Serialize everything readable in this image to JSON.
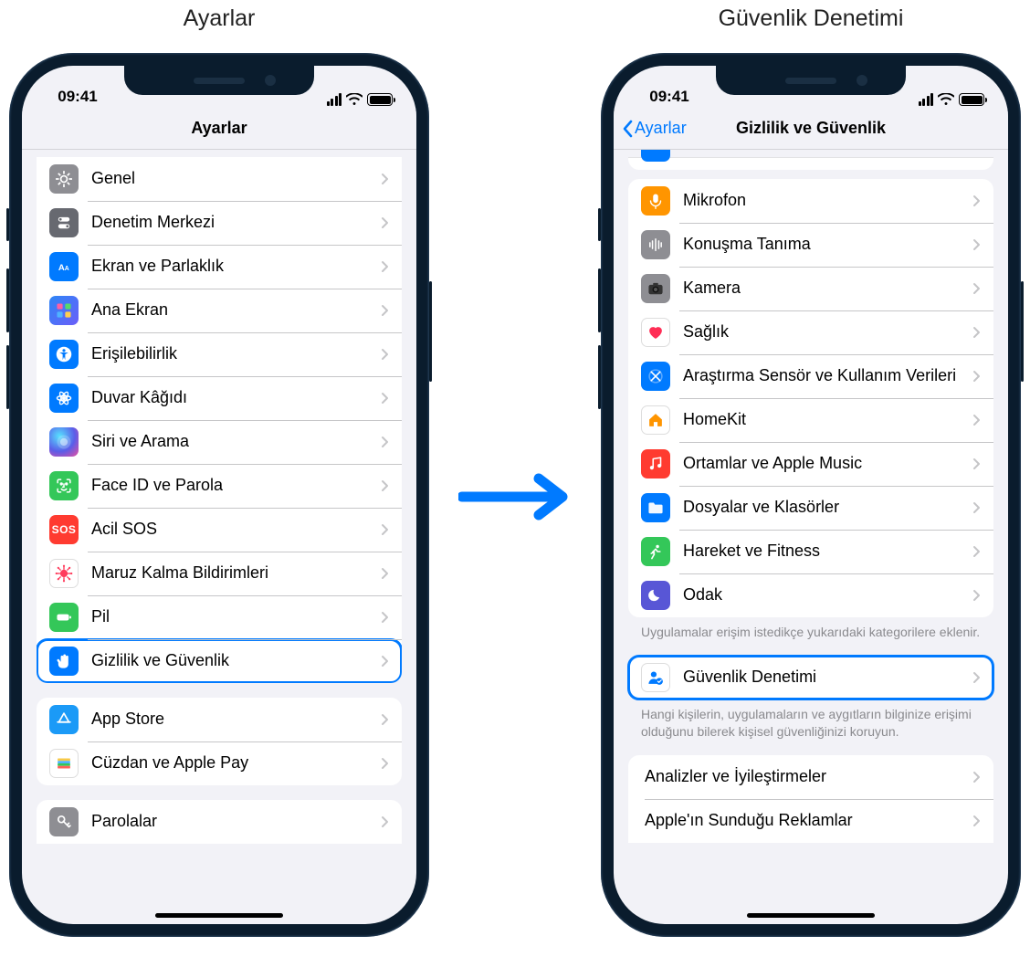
{
  "headings": {
    "left": "Ayarlar",
    "right": "Güvenlik Denetimi"
  },
  "status": {
    "time": "09:41"
  },
  "left_phone": {
    "nav_title": "Ayarlar",
    "groups": [
      {
        "rows": [
          {
            "id": "general",
            "label": "Genel",
            "icon": "gear-icon",
            "bg": "bg-gray"
          },
          {
            "id": "control-center",
            "label": "Denetim Merkezi",
            "icon": "switches-icon",
            "bg": "bg-darkgray"
          },
          {
            "id": "display",
            "label": "Ekran ve Parlaklık",
            "icon": "text-size-icon",
            "bg": "bg-blue"
          },
          {
            "id": "home-screen",
            "label": "Ana Ekran",
            "icon": "apps-grid-icon",
            "bg": "bg-home"
          },
          {
            "id": "accessibility",
            "label": "Erişilebilirlik",
            "icon": "accessibility-icon",
            "bg": "bg-blue"
          },
          {
            "id": "wallpaper",
            "label": "Duvar Kâğıdı",
            "icon": "flower-icon",
            "bg": "bg-blue"
          },
          {
            "id": "siri",
            "label": "Siri ve Arama",
            "icon": "siri-icon",
            "bg": "bg-siri"
          },
          {
            "id": "faceid",
            "label": "Face ID ve Parola",
            "icon": "faceid-icon",
            "bg": "bg-green"
          },
          {
            "id": "sos",
            "label": "Acil SOS",
            "icon": "sos-icon",
            "bg": "bg-red"
          },
          {
            "id": "exposure",
            "label": "Maruz Kalma Bildirimleri",
            "icon": "virus-icon",
            "bg": "bg-white"
          },
          {
            "id": "battery",
            "label": "Pil",
            "icon": "battery-icon",
            "bg": "bg-green"
          },
          {
            "id": "privacy",
            "label": "Gizlilik ve Güvenlik",
            "icon": "hand-icon",
            "bg": "bg-blue",
            "highlight": true
          }
        ]
      },
      {
        "rows": [
          {
            "id": "appstore",
            "label": "App Store",
            "icon": "appstore-icon",
            "bg": "bg-appstore"
          },
          {
            "id": "wallet",
            "label": "Cüzdan ve Apple Pay",
            "icon": "wallet-icon",
            "bg": "bg-white"
          }
        ]
      },
      {
        "partial": true,
        "rows": [
          {
            "id": "passwords",
            "label": "Parolalar",
            "icon": "key-icon",
            "bg": "bg-key"
          }
        ]
      }
    ]
  },
  "right_phone": {
    "nav_title": "Gizlilik ve Güvenlik",
    "back_label": "Ayarlar",
    "sections": [
      {
        "type": "partial_top"
      },
      {
        "type": "group",
        "rows": [
          {
            "id": "microphone",
            "label": "Mikrofon",
            "icon": "mic-icon",
            "bg": "bg-orange"
          },
          {
            "id": "speech",
            "label": "Konuşma Tanıma",
            "icon": "waveform-icon",
            "bg": "bg-mid"
          },
          {
            "id": "camera",
            "label": "Kamera",
            "icon": "camera-icon",
            "bg": "bg-mid"
          },
          {
            "id": "health",
            "label": "Sağlık",
            "icon": "heart-icon",
            "bg": "bg-white"
          },
          {
            "id": "research",
            "label": "Araştırma Sensör ve Kullanım Verileri",
            "icon": "research-icon",
            "bg": "bg-blue"
          },
          {
            "id": "homekit",
            "label": "HomeKit",
            "icon": "home-icon",
            "bg": "bg-white"
          },
          {
            "id": "media",
            "label": "Ortamlar ve Apple Music",
            "icon": "music-icon",
            "bg": "bg-red"
          },
          {
            "id": "files",
            "label": "Dosyalar ve Klasörler",
            "icon": "folder-icon",
            "bg": "bg-blue"
          },
          {
            "id": "motion",
            "label": "Hareket ve Fitness",
            "icon": "running-icon",
            "bg": "bg-green"
          },
          {
            "id": "focus",
            "label": "Odak",
            "icon": "moon-icon",
            "bg": "bg-purple"
          }
        ],
        "footer": "Uygulamalar erişim istedikçe yukarıdaki kategorilere eklenir."
      },
      {
        "type": "group",
        "highlight": true,
        "rows": [
          {
            "id": "safety-check",
            "label": "Güvenlik Denetimi",
            "icon": "person-check-icon",
            "bg": "bg-white"
          }
        ],
        "footer": "Hangi kişilerin, uygulamaların ve aygıtların bilginize erişimi olduğunu bilerek kişisel güvenliğinizi koruyun."
      },
      {
        "type": "group",
        "partial_bottom": true,
        "rows": [
          {
            "id": "analytics",
            "label": "Analizler ve İyileştirmeler",
            "icon": "",
            "bg": "",
            "no_icon": true
          },
          {
            "id": "apple-ads",
            "label": "Apple'ın Sunduğu Reklamlar",
            "icon": "",
            "bg": "",
            "no_icon": true
          }
        ]
      }
    ]
  }
}
